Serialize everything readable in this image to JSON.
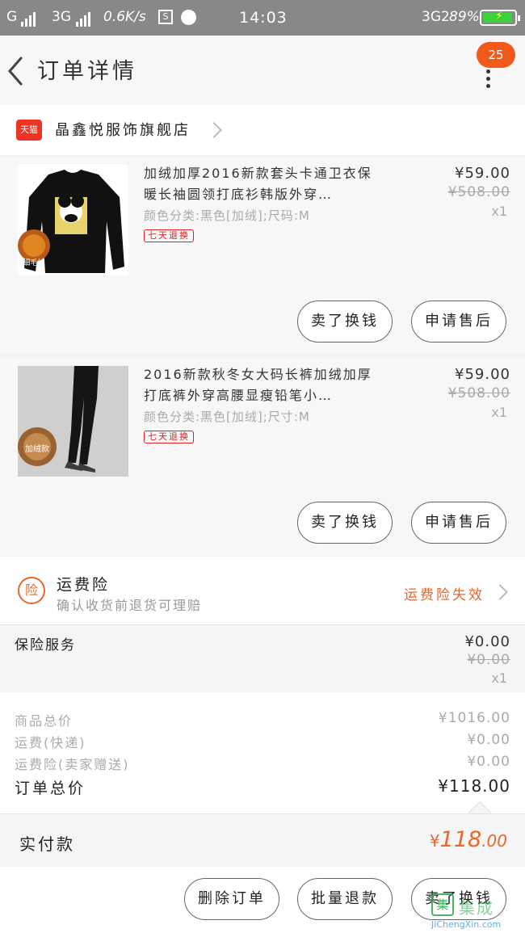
{
  "status_bar": {
    "carrier1": "G",
    "carrier2": "3G",
    "speed": "0.6K/s",
    "time": "14:03",
    "network": "3G2",
    "battery": "89%"
  },
  "header": {
    "title": "订单详情",
    "notification_count": "25"
  },
  "shop": {
    "badge_text": "天猫",
    "name": "晶鑫悦服饰旗舰店"
  },
  "products": [
    {
      "title": "加绒加厚2016新款套头卡通卫衣保暖长袖圆领打底衫韩版外穿…",
      "sku": "颜色分类:黑色[加绒];尺码:M",
      "tag": "七天退换",
      "price": "¥59.00",
      "original_price": "¥508.00",
      "quantity": "x1",
      "thumb_badge": "细毛绒",
      "actions": [
        "卖了换钱",
        "申请售后"
      ]
    },
    {
      "title": "2016新款秋冬女大码长裤加绒加厚打底裤外穿高腰显瘦铅笔小…",
      "sku": "颜色分类:黑色[加绒];尺寸:M",
      "tag": "七天退换",
      "price": "¥59.00",
      "original_price": "¥508.00",
      "quantity": "x1",
      "thumb_badge": "加绒款",
      "actions": [
        "卖了换钱",
        "申请售后"
      ]
    }
  ],
  "freight_insurance": {
    "icon_text": "险",
    "title": "运费险",
    "subtitle": "确认收货前退货可理赔",
    "status": "运费险失效"
  },
  "insurance_service": {
    "label": "保险服务",
    "price": "¥0.00",
    "original_price": "¥0.00",
    "quantity": "x1"
  },
  "totals": {
    "rows": [
      {
        "label": "商品总价",
        "value": "¥1016.00"
      },
      {
        "label": "运费(快递)",
        "value": "¥0.00"
      },
      {
        "label": "运费险(卖家赠送)",
        "value": "¥0.00"
      }
    ],
    "order_total_label": "订单总价",
    "order_total_value": "¥118.00"
  },
  "payment": {
    "label": "实付款",
    "currency": "¥",
    "integer": "118",
    "decimal": ".00"
  },
  "bottom_actions": [
    "删除订单",
    "批量退款",
    "卖了换钱"
  ],
  "watermark": {
    "cn": "集成",
    "url": "JiChengXin.com"
  },
  "colors": {
    "accent_orange": "#e8672b",
    "badge_orange": "#f25a1a",
    "tag_red": "#dd2222"
  }
}
